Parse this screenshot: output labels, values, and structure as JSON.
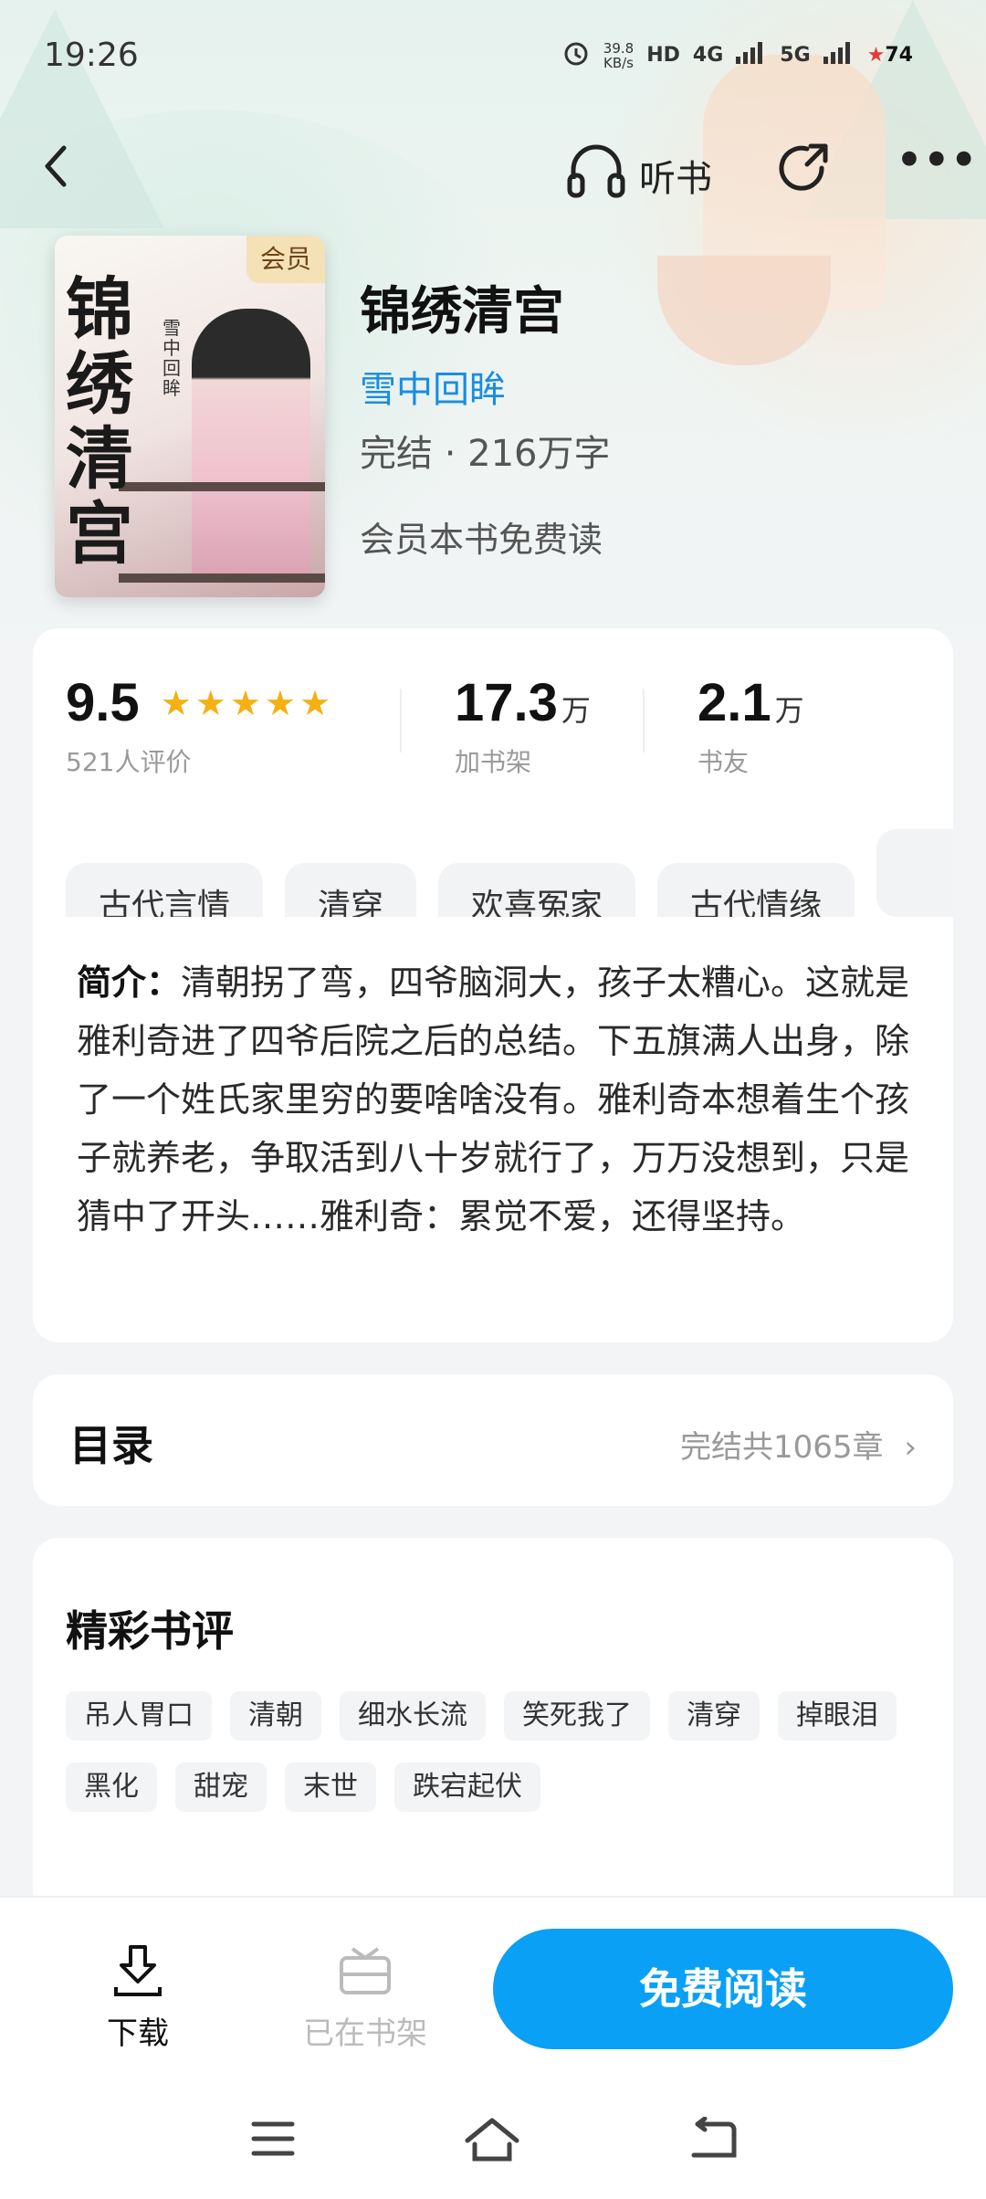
{
  "status_bar": {
    "time": "19:26",
    "net_speed_value": "39.8",
    "net_speed_unit": "KB/s",
    "hd": "HD",
    "net_4g": "4G",
    "net_5g": "5G",
    "battery": "74"
  },
  "nav": {
    "listen_label": "听书"
  },
  "book": {
    "vip_tag": "会员",
    "cover_title": "锦绣清宫",
    "cover_author": "雪中回眸",
    "title": "锦绣清宫",
    "author": "雪中回眸",
    "status": "完结 · 216万字",
    "vip_note": "会员本书免费读"
  },
  "stats": {
    "rating": "9.5",
    "rating_stars": 5,
    "rating_label": "521人评价",
    "shelf_num": "17.3",
    "shelf_unit": "万",
    "shelf_label": "加书架",
    "fans_num": "2.1",
    "fans_unit": "万",
    "fans_label": "书友"
  },
  "tags": [
    "古代言情",
    "清穿",
    "欢喜冤家",
    "古代情缘",
    ""
  ],
  "synopsis": {
    "label": "简介：",
    "text": "清朝拐了弯，四爷脑洞大，孩子太糟心。这就是雅利奇进了四爷后院之后的总结。下五旗满人出身，除了一个姓氏家里穷的要啥啥没有。雅利奇本想着生个孩子就养老，争取活到八十岁就行了，万万没想到，只是猜中了开头……雅利奇：累觉不爱，还得坚持。"
  },
  "toc": {
    "title": "目录",
    "info": "完结共1065章"
  },
  "reviews": {
    "title": "精彩书评",
    "chips": [
      "吊人胃口",
      "清朝",
      "细水长流",
      "笑死我了",
      "清穿",
      "掉眼泪",
      "黑化",
      "甜宠",
      "末世",
      "跌宕起伏"
    ]
  },
  "bottom": {
    "download_label": "下载",
    "shelf_label": "已在书架",
    "read_label": "免费阅读"
  }
}
